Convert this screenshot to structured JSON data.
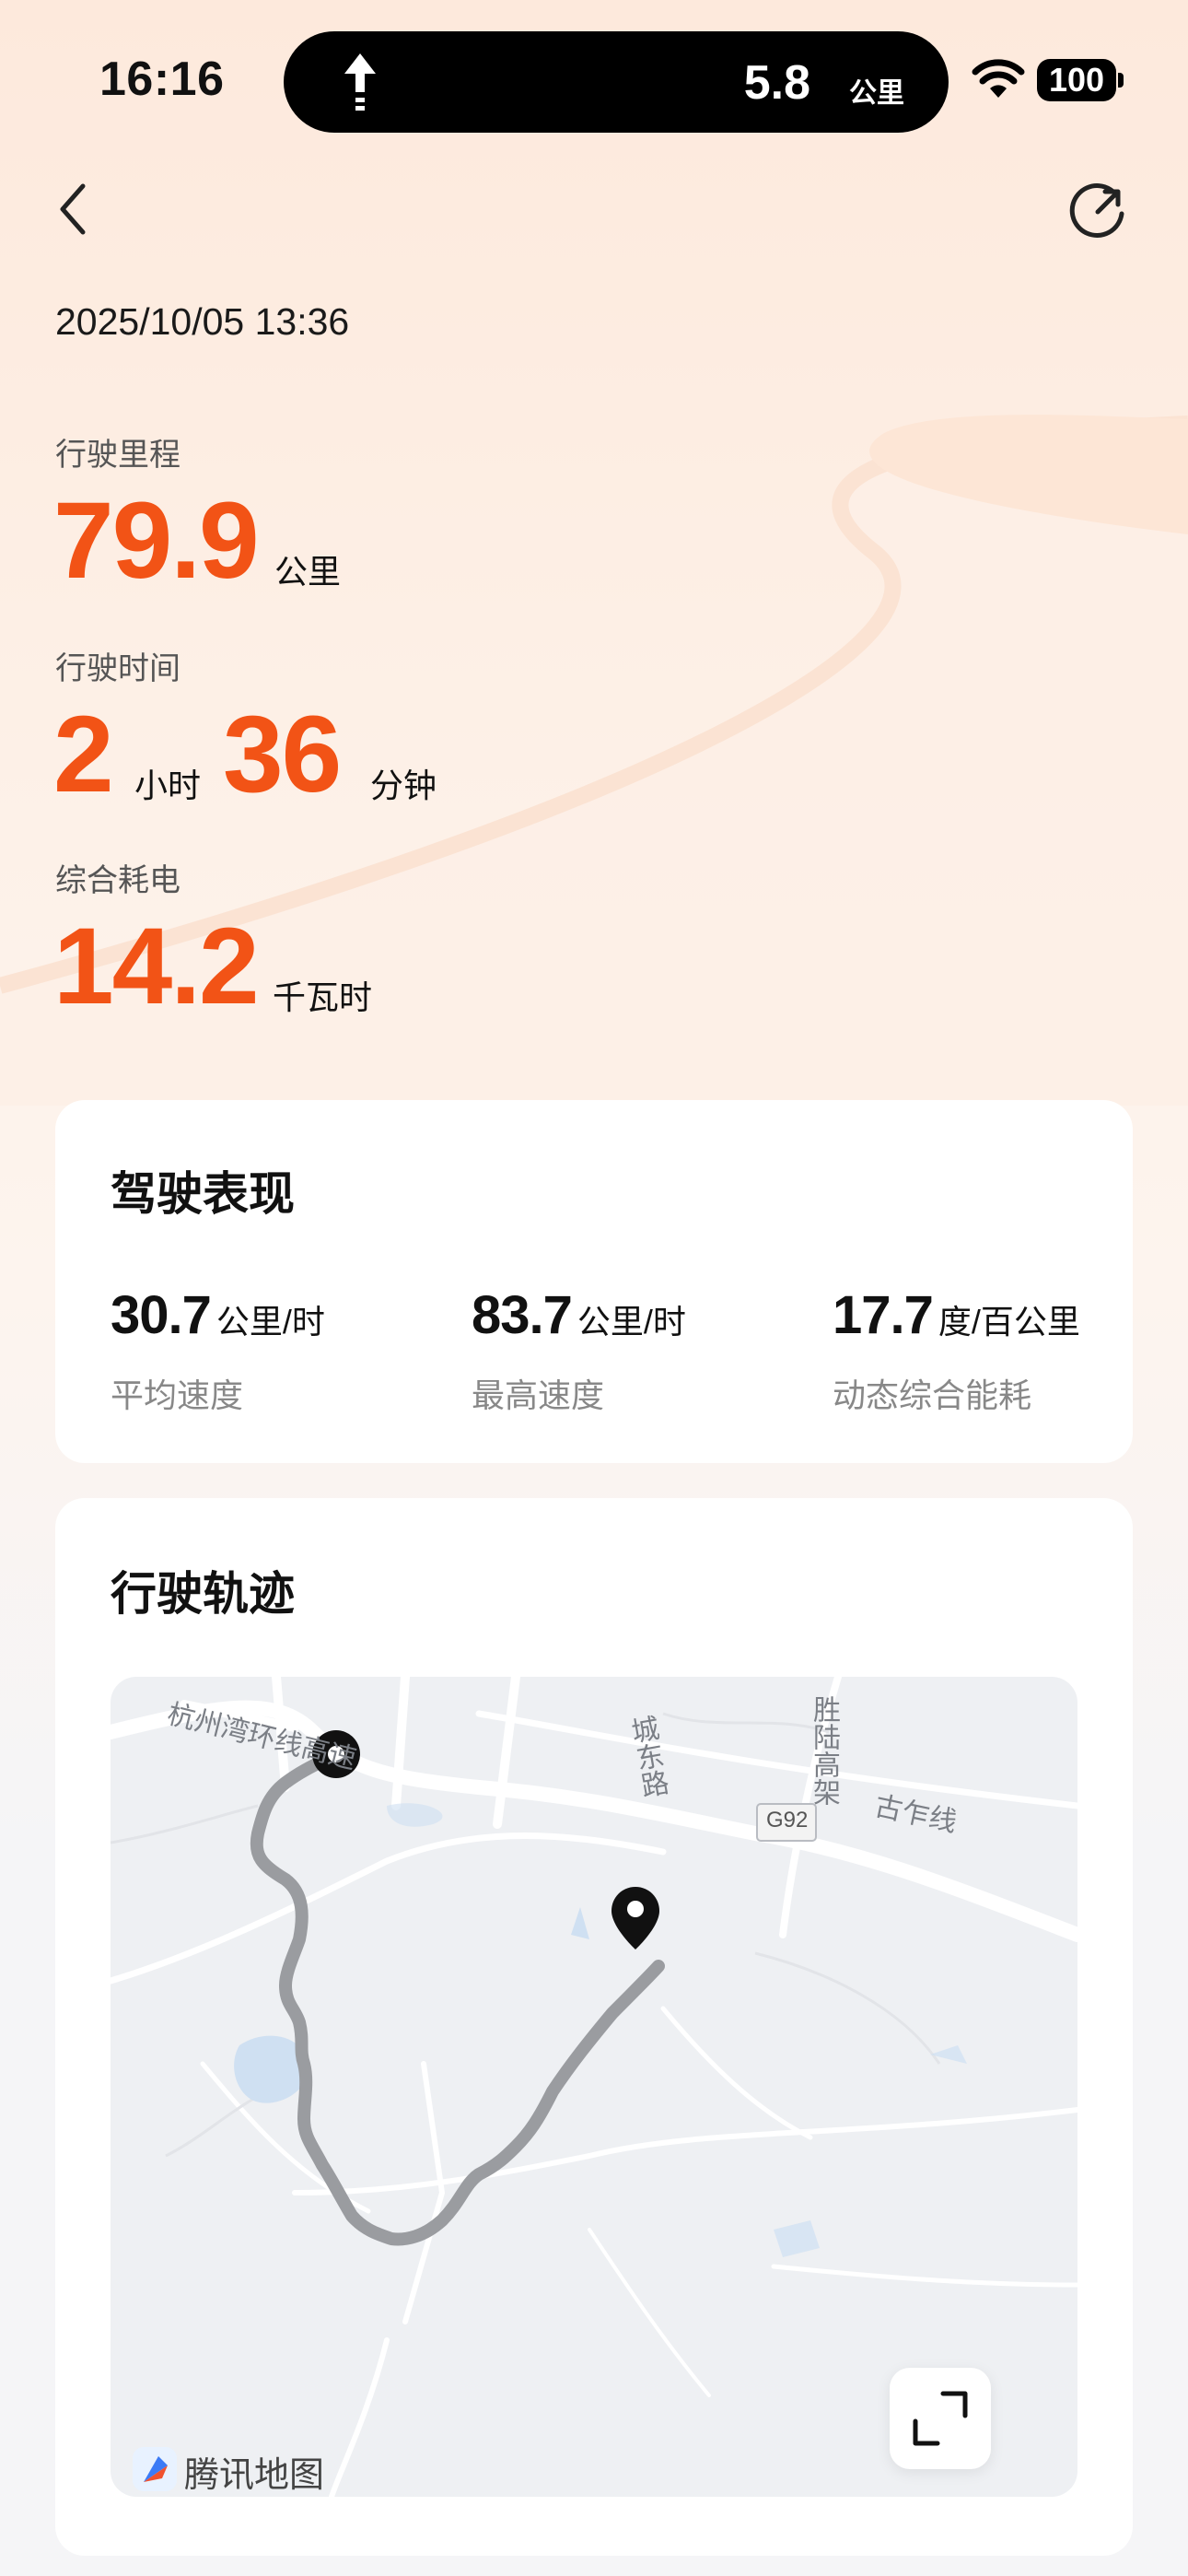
{
  "status_bar": {
    "time": "16:16",
    "nav_distance": "5.8",
    "nav_unit": "公里",
    "battery": "100"
  },
  "header": {
    "datetime": "2025/10/05 13:36"
  },
  "summary": {
    "distance_label": "行驶里程",
    "distance_value": "79.9",
    "distance_unit": "公里",
    "time_label": "行驶时间",
    "hours_value": "2",
    "hours_unit": "小时",
    "minutes_value": "36",
    "minutes_unit": "分钟",
    "energy_label": "综合耗电",
    "energy_value": "14.2",
    "energy_unit": "千瓦时"
  },
  "performance": {
    "title": "驾驶表现",
    "stats": [
      {
        "value": "30.7",
        "unit": "公里/时",
        "label": "平均速度"
      },
      {
        "value": "83.7",
        "unit": "公里/时",
        "label": "最高速度"
      },
      {
        "value": "17.7",
        "unit": "度/百公里",
        "label": "动态综合能耗"
      }
    ]
  },
  "trajectory": {
    "title": "行驶轨迹",
    "map_labels": {
      "road1": "杭州湾环线高速",
      "road2": "城东路",
      "road3": "胜陆高架",
      "road4": "古乍线",
      "highway_badge": "G92"
    },
    "provider": "腾讯地图"
  },
  "colors": {
    "accent": "#f25316",
    "route": "#9a9ca0"
  }
}
